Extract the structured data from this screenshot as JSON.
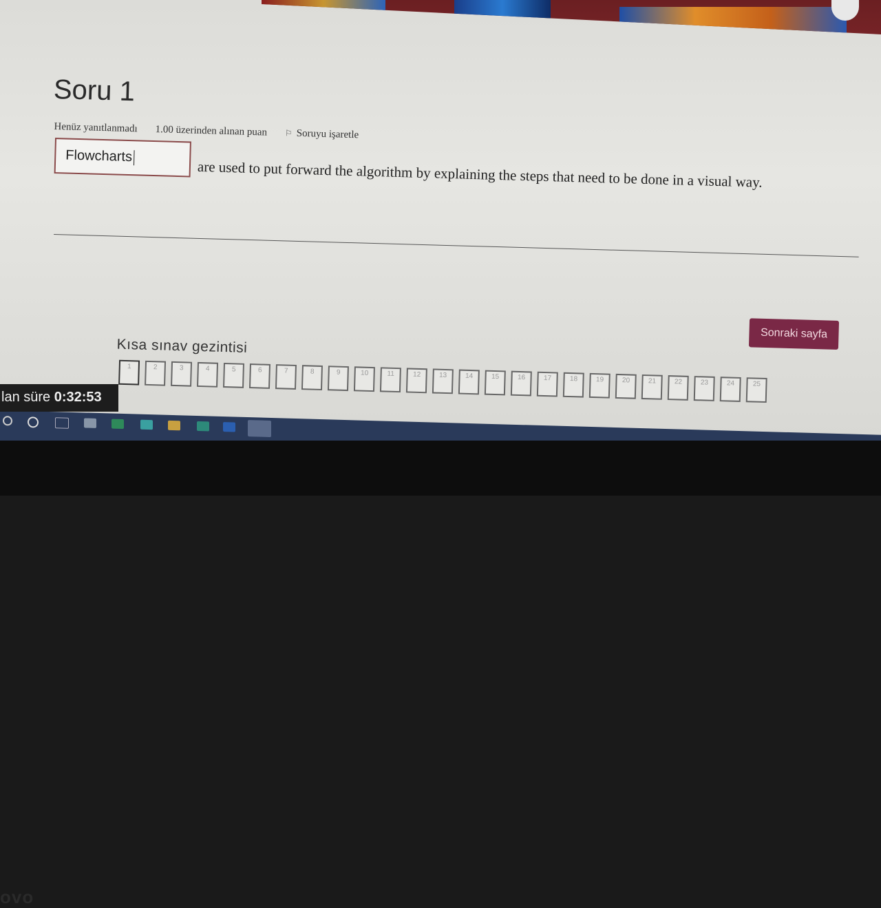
{
  "question": {
    "title": "Soru 1",
    "status": "Henüz yanıtlanmadı",
    "points": "1.00 üzerinden alınan puan",
    "flag_label": "Soruyu işaretle",
    "answer_value": "Flowcharts",
    "text": "are used to put forward the algorithm by explaining the steps that need to be done in a visual way."
  },
  "navigation": {
    "next_label": "Sonraki sayfa",
    "title": "Kısa sınav gezintisi",
    "pages": [
      "1",
      "2",
      "3",
      "4",
      "5",
      "6",
      "7",
      "8",
      "9",
      "10",
      "11",
      "12",
      "13",
      "14",
      "15",
      "16",
      "17",
      "18",
      "19",
      "20",
      "21",
      "22",
      "23",
      "24",
      "25"
    ]
  },
  "timer": {
    "label": "lan süre",
    "value": "0:32:53"
  },
  "laptop": {
    "brand": "ovo"
  },
  "colors": {
    "accent": "#7a2846",
    "banner": "#6b1f22",
    "answer_border": "#8a4a4a"
  }
}
